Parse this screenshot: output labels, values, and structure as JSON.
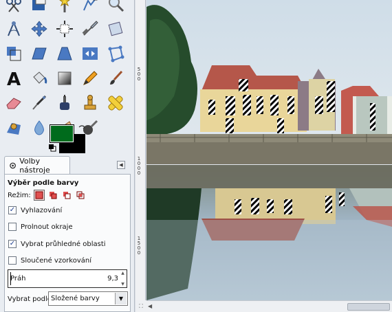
{
  "toolbox": {
    "tools": [
      {
        "name": "scissors-select-icon"
      },
      {
        "name": "foreground-select-icon"
      },
      {
        "name": "fuzzy-select-icon"
      },
      {
        "name": "paths-icon"
      },
      {
        "name": "magnify-icon"
      },
      {
        "name": "measure-icon"
      },
      {
        "name": "move-icon"
      },
      {
        "name": "align-icon"
      },
      {
        "name": "crop-icon"
      },
      {
        "name": "rotate-icon"
      },
      {
        "name": "scale-icon"
      },
      {
        "name": "shear-icon"
      },
      {
        "name": "perspective-icon"
      },
      {
        "name": "flip-icon"
      },
      {
        "name": "cage-transform-icon"
      },
      {
        "name": "text-icon"
      },
      {
        "name": "bucket-fill-icon"
      },
      {
        "name": "blend-icon"
      },
      {
        "name": "pencil-icon"
      },
      {
        "name": "paintbrush-icon"
      },
      {
        "name": "eraser-icon"
      },
      {
        "name": "airbrush-icon"
      },
      {
        "name": "ink-icon"
      },
      {
        "name": "clone-icon"
      },
      {
        "name": "heal-icon"
      },
      {
        "name": "perspective-clone-icon"
      },
      {
        "name": "blur-icon"
      },
      {
        "name": "smudge-icon"
      },
      {
        "name": "dodge-burn-icon"
      }
    ],
    "colors": {
      "foreground": "#006b1c",
      "background": "#000000"
    }
  },
  "options": {
    "tab_label": "Volby nástroje",
    "title": "Výběr podle barvy",
    "mode_label": "Režim:",
    "antialiasing": {
      "label": "Vyhlazování",
      "checked": true
    },
    "feather": {
      "label": "Prolnout okraje",
      "checked": false
    },
    "transparent": {
      "label": "Vybrat průhledné oblasti",
      "checked": true
    },
    "merged": {
      "label": "Sloučené vzorkování",
      "checked": false
    },
    "threshold": {
      "label": "Práh",
      "value": "9,3"
    },
    "select_by": {
      "label": "Vybrat podle:",
      "value": "Složené barvy"
    }
  },
  "ruler": {
    "labels": [
      "500",
      "1000",
      "1500"
    ]
  }
}
